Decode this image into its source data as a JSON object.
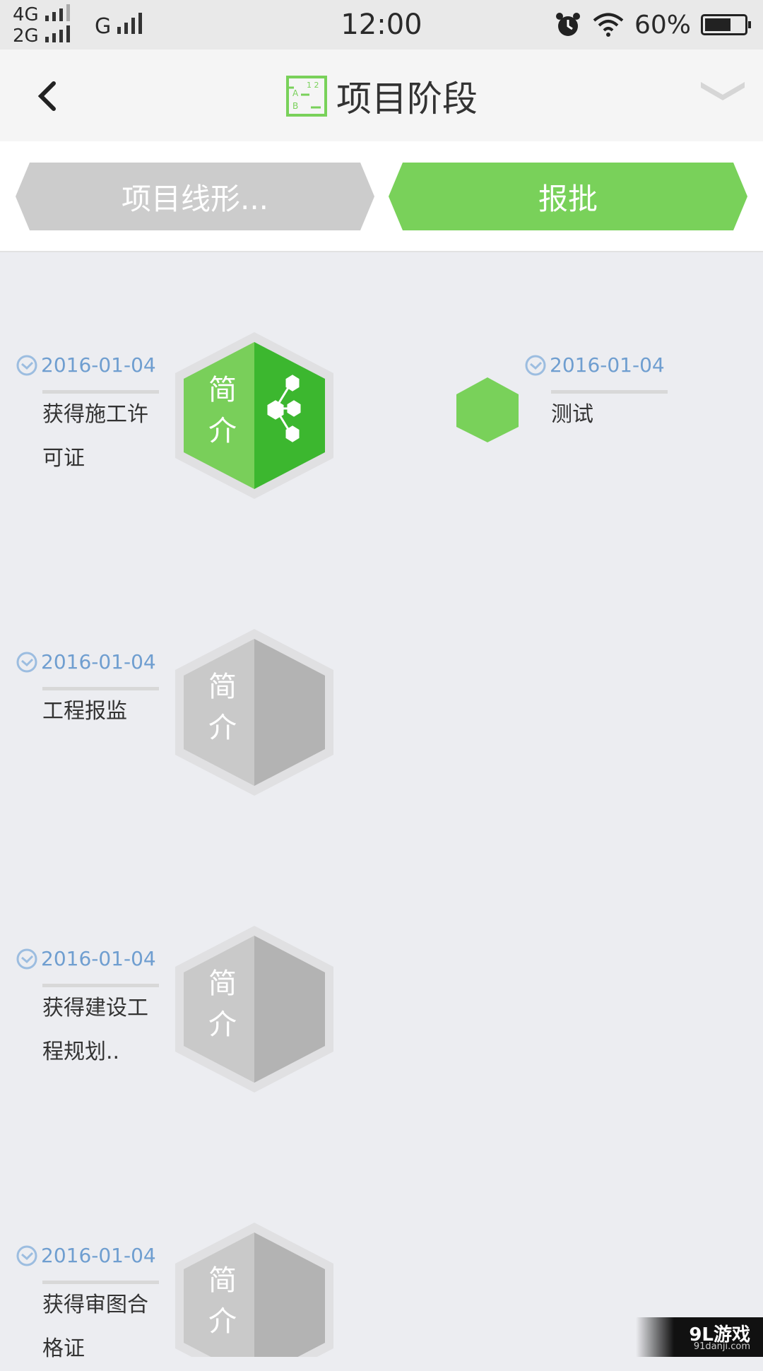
{
  "status": {
    "net_top": "4G",
    "net_bottom": "2G",
    "net_g": "G",
    "time": "12:00",
    "battery": "60%"
  },
  "nav": {
    "title": "项目阶段"
  },
  "tabs": [
    {
      "label": "项目线形...",
      "color": "#cccccc"
    },
    {
      "label": "报批",
      "color": "#79d15a"
    }
  ],
  "hex_text": {
    "top": "简",
    "bottom": "介"
  },
  "items": [
    {
      "date": "2016-01-04",
      "line1": "获得施工许",
      "line2": "可证"
    },
    {
      "date": "2016-01-04",
      "line1": "工程报监",
      "line2": ""
    },
    {
      "date": "2016-01-04",
      "line1": "获得建设工",
      "line2": "程规划.."
    },
    {
      "date": "2016-01-04",
      "line1": "获得审图合",
      "line2": "格证"
    }
  ],
  "side_item": {
    "date": "2016-01-04",
    "label": "测试"
  },
  "colors": {
    "accent_green": "#79d15a",
    "dark_green": "#3cb72f",
    "gray": "#c8c8c8",
    "date_blue": "#6f9ed0"
  },
  "watermark": {
    "brand": "9L游戏",
    "url": "91danji.com"
  }
}
